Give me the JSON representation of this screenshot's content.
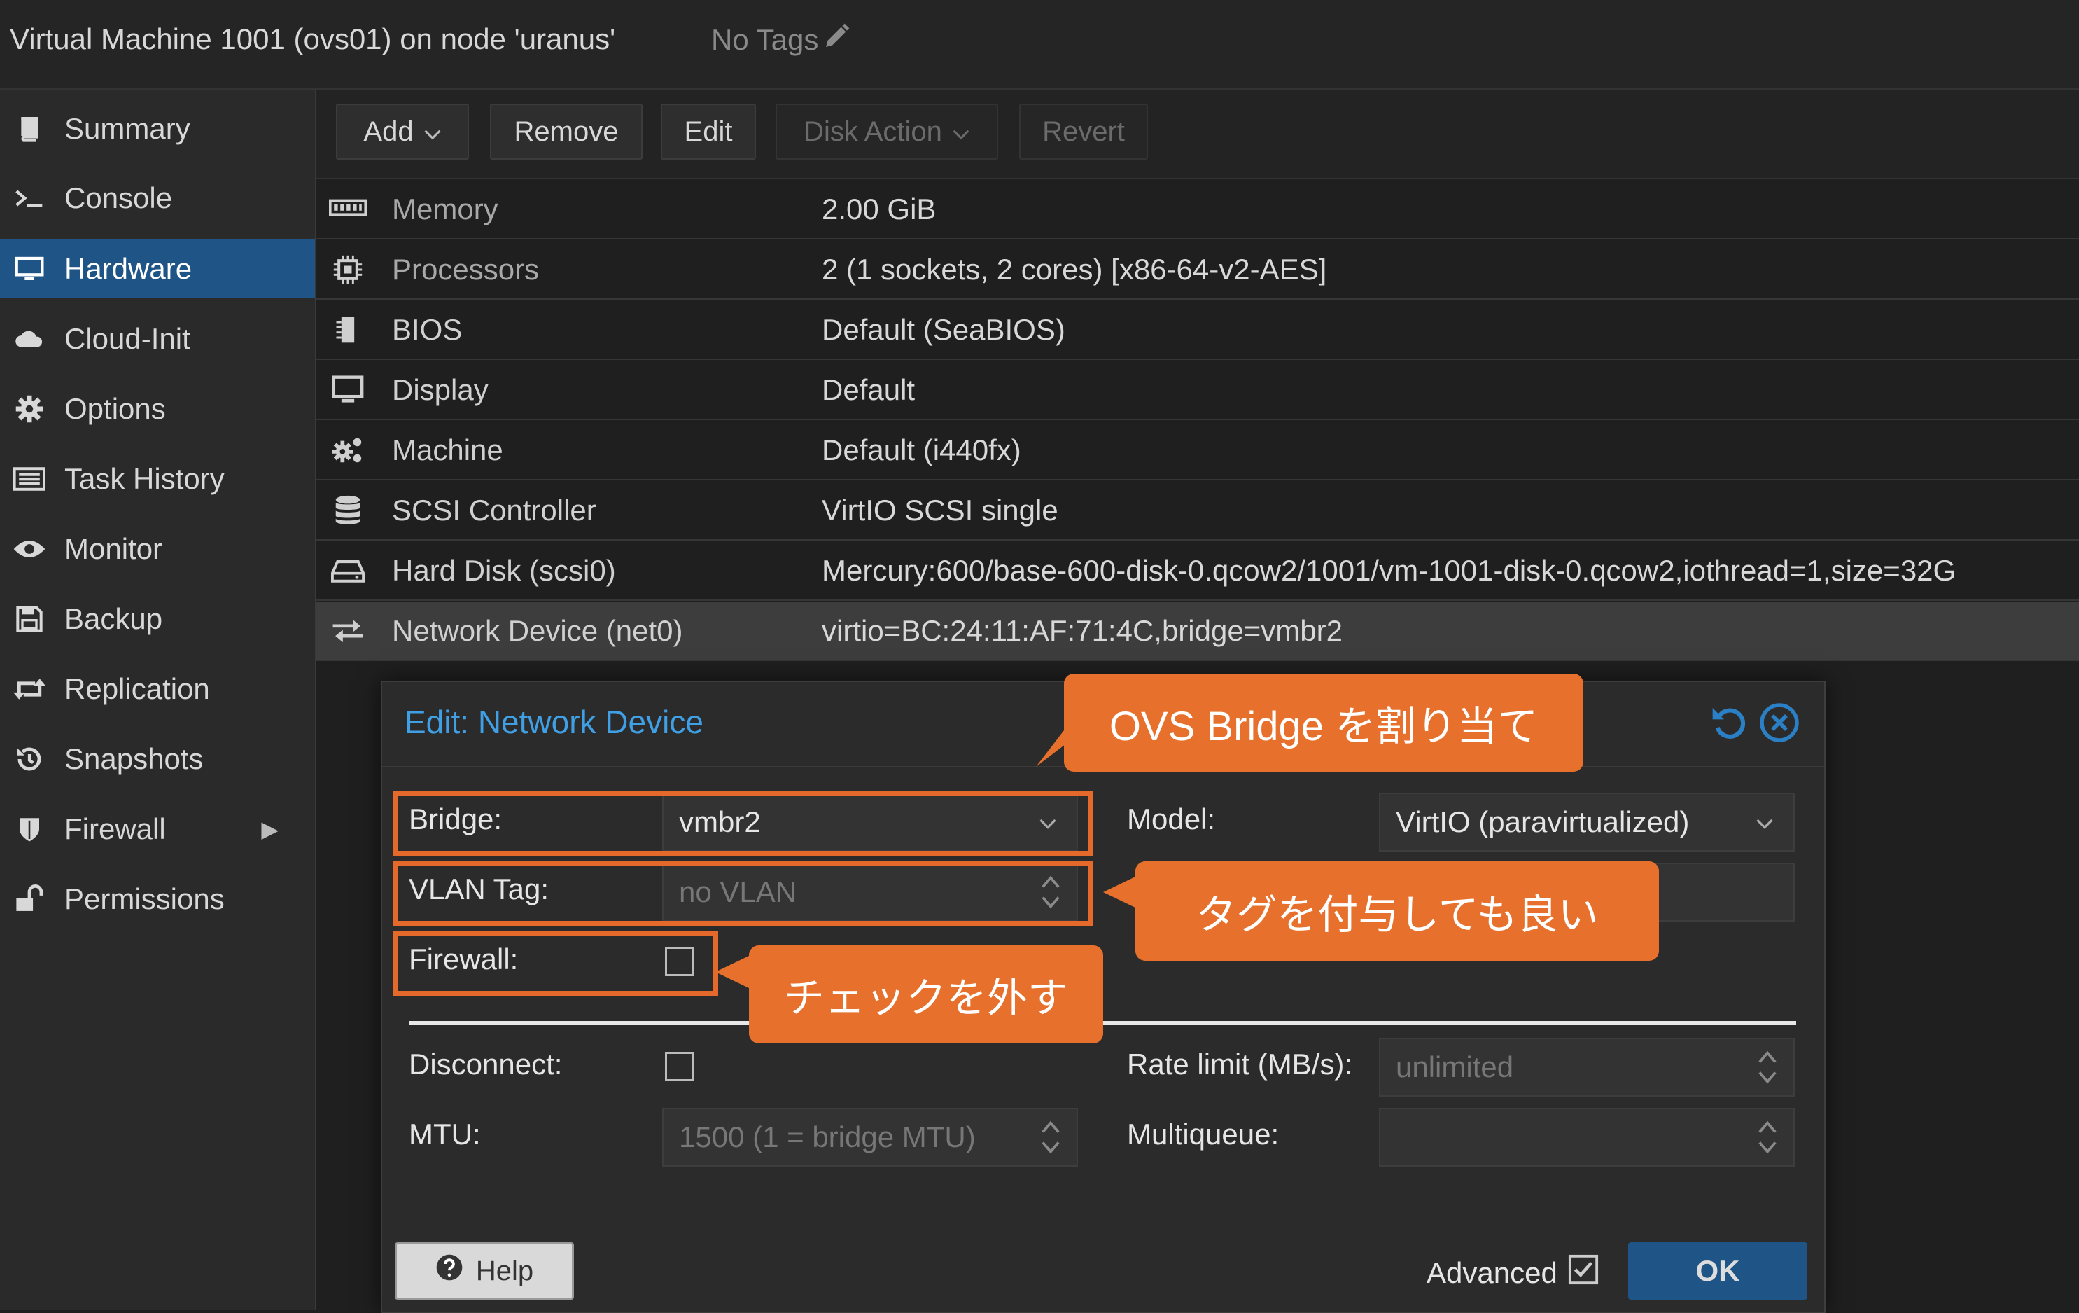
{
  "header": {
    "vm_title": "Virtual Machine 1001 (ovs01) on node 'uranus'",
    "tags_label": "No Tags"
  },
  "sidebar": {
    "items": [
      {
        "label": "Summary",
        "icon": "book-icon"
      },
      {
        "label": "Console",
        "icon": "terminal-icon"
      },
      {
        "label": "Hardware",
        "icon": "monitor-icon",
        "active": true
      },
      {
        "label": "Cloud-Init",
        "icon": "cloud-icon"
      },
      {
        "label": "Options",
        "icon": "gear-icon"
      },
      {
        "label": "Task History",
        "icon": "list-icon"
      },
      {
        "label": "Monitor",
        "icon": "eye-icon"
      },
      {
        "label": "Backup",
        "icon": "floppy-icon"
      },
      {
        "label": "Replication",
        "icon": "retweet-icon"
      },
      {
        "label": "Snapshots",
        "icon": "history-icon"
      },
      {
        "label": "Firewall",
        "icon": "shield-icon"
      },
      {
        "label": "Permissions",
        "icon": "unlock-icon"
      }
    ]
  },
  "toolbar": {
    "add": "Add",
    "remove": "Remove",
    "edit": "Edit",
    "disk_action": "Disk Action",
    "revert": "Revert"
  },
  "hardware": [
    {
      "key": "Memory",
      "value": "2.00 GiB",
      "icon": "memory-icon"
    },
    {
      "key": "Processors",
      "value": "2 (1 sockets, 2 cores) [x86-64-v2-AES]",
      "icon": "cpu-icon"
    },
    {
      "key": "BIOS",
      "value": "Default (SeaBIOS)",
      "icon": "chip-icon"
    },
    {
      "key": "Display",
      "value": "Default",
      "icon": "desktop-icon"
    },
    {
      "key": "Machine",
      "value": "Default (i440fx)",
      "icon": "cogs-icon"
    },
    {
      "key": "SCSI Controller",
      "value": "VirtIO SCSI single",
      "icon": "database-icon"
    },
    {
      "key": "Hard Disk (scsi0)",
      "value": "Mercury:600/base-600-disk-0.qcow2/1001/vm-1001-disk-0.qcow2,iothread=1,size=32G",
      "icon": "hdd-icon"
    },
    {
      "key": "Network Device (net0)",
      "value": "virtio=BC:24:11:AF:71:4C,bridge=vmbr2",
      "icon": "exchange-icon"
    }
  ],
  "dialog": {
    "title": "Edit: Network Device",
    "bridge_label": "Bridge:",
    "bridge_value": "vmbr2",
    "vlan_label": "VLAN Tag:",
    "vlan_placeholder": "no VLAN",
    "firewall_label": "Firewall:",
    "model_label": "Model:",
    "model_value": "VirtIO (paravirtualized)",
    "disconnect_label": "Disconnect:",
    "mtu_label": "MTU:",
    "mtu_placeholder": "1500 (1 = bridge MTU)",
    "rate_label": "Rate limit (MB/s):",
    "rate_placeholder": "unlimited",
    "multiqueue_label": "Multiqueue:",
    "help": "Help",
    "advanced": "Advanced",
    "ok": "OK"
  },
  "callouts": {
    "bridge": "OVS Bridge を割り当て",
    "vlan": "タグを付与しても良い",
    "firewall": "チェックを外す"
  },
  "colors": {
    "accent": "#1e5586",
    "title_blue": "#3fa0e6",
    "callout": "#e6702c"
  }
}
